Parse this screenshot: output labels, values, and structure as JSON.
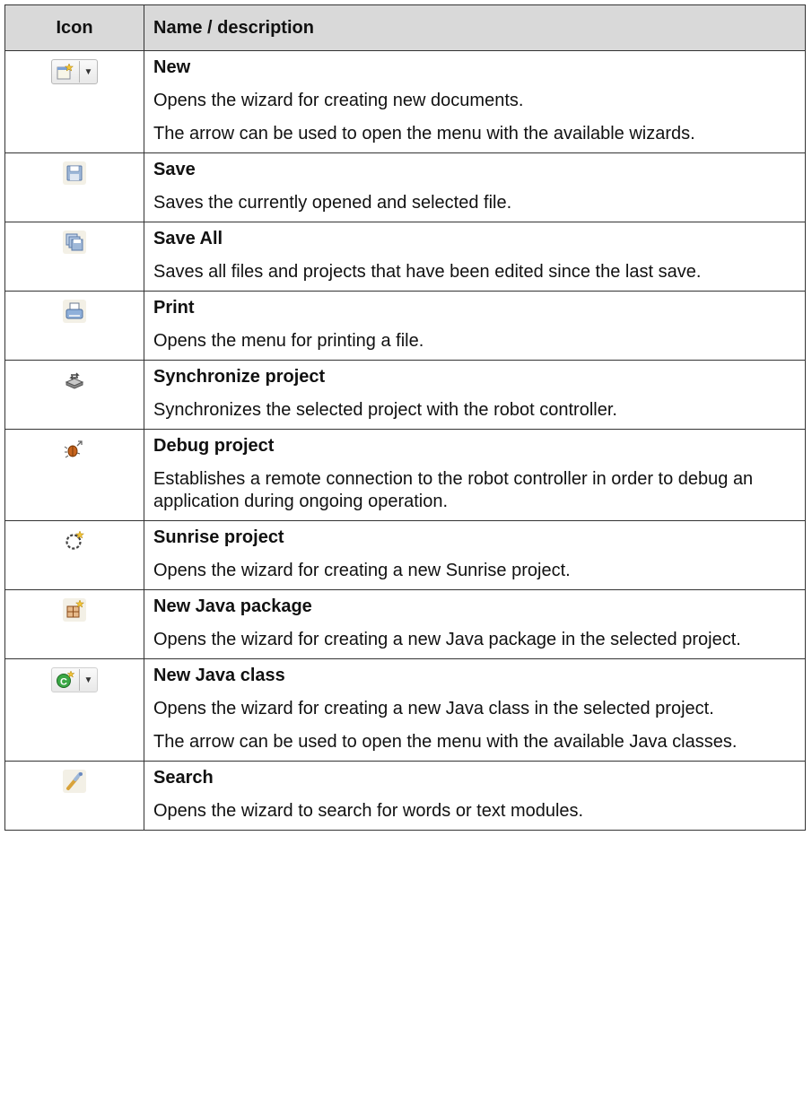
{
  "table": {
    "header": {
      "icon": "Icon",
      "name": "Name / description"
    },
    "rows": [
      {
        "icon": "new-wizard-icon",
        "title": "New",
        "paras": [
          "Opens the wizard for creating new documents.",
          "The arrow can be used to open the menu with the available wizards."
        ]
      },
      {
        "icon": "save-icon",
        "title": "Save",
        "paras": [
          "Saves the currently opened and selected file."
        ]
      },
      {
        "icon": "save-all-icon",
        "title": "Save All",
        "paras": [
          "Saves all files and projects that have been edited since the last save."
        ]
      },
      {
        "icon": "print-icon",
        "title": "Print",
        "paras": [
          "Opens the menu for printing a file."
        ]
      },
      {
        "icon": "synchronize-icon",
        "title": "Synchronize project",
        "paras": [
          "Synchronizes the selected project with the robot controller."
        ]
      },
      {
        "icon": "debug-icon",
        "title": "Debug project",
        "paras": [
          "Establishes a remote connection to the robot controller in order to debug an application during ongoing operation."
        ]
      },
      {
        "icon": "sunrise-project-icon",
        "title": "Sunrise project",
        "paras": [
          "Opens the wizard for creating a new Sunrise project."
        ]
      },
      {
        "icon": "java-package-icon",
        "title": "New Java package",
        "paras": [
          "Opens the wizard for creating a new Java package in the selected project."
        ]
      },
      {
        "icon": "java-class-icon",
        "title": "New Java class",
        "paras": [
          "Opens the wizard for creating a new Java class in the selected project.",
          "The arrow can be used to open the menu with the available Java classes."
        ]
      },
      {
        "icon": "search-icon",
        "title": "Search",
        "paras": [
          "Opens the wizard to search for words or text modules."
        ]
      }
    ]
  }
}
